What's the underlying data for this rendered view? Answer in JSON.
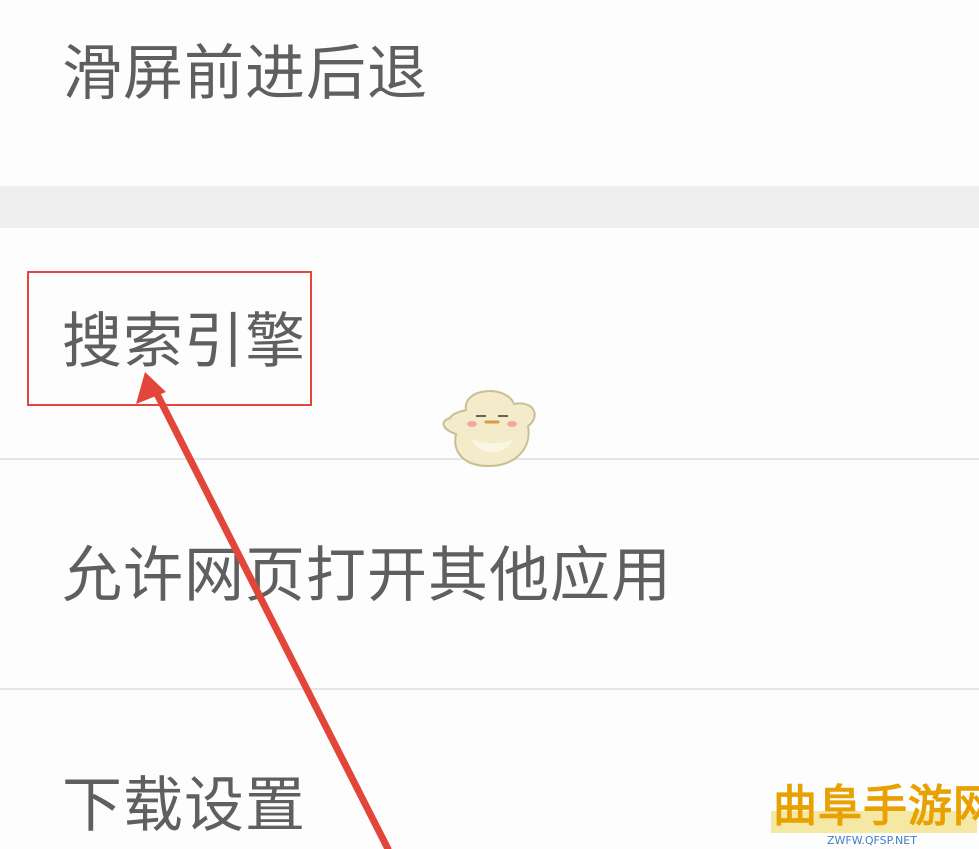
{
  "settings": {
    "items": [
      {
        "label": "滑屏前进后退"
      },
      {
        "label": "搜索引擎"
      },
      {
        "label": "允许网页打开其他应用"
      },
      {
        "label": "下载设置"
      }
    ]
  },
  "annotation": {
    "highlight_color": "#e2463b",
    "arrow_color": "#e2463b"
  },
  "watermark": {
    "title": "曲阜手游网",
    "url": "ZWFW.QFSP.NET",
    "title_color": "#e8a100",
    "url_color": "#3f7fc6"
  }
}
